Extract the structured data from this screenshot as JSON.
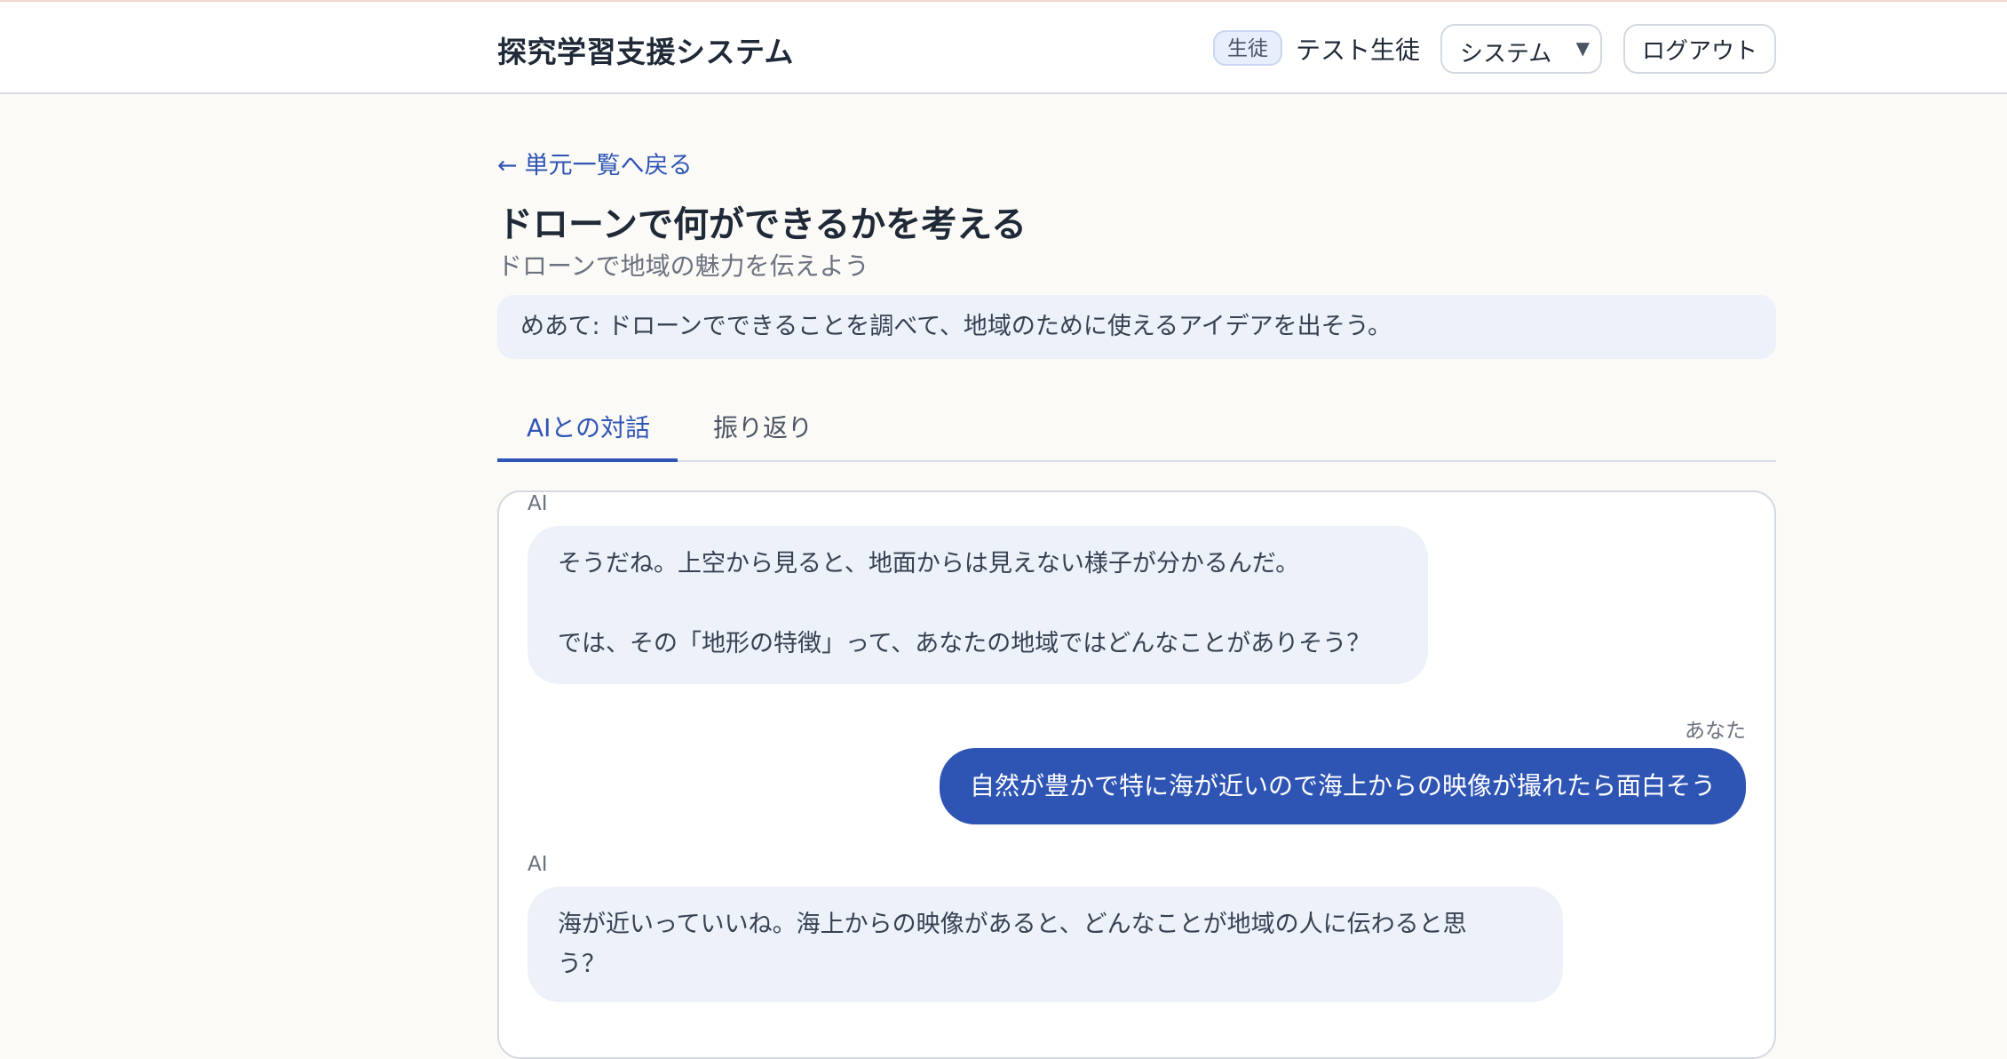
{
  "header": {
    "app_title": "探究学習支援システム",
    "role_badge": "生徒",
    "user_name": "テスト生徒",
    "mode_select": {
      "selected": "システム"
    },
    "logout_label": "ログアウト"
  },
  "unit": {
    "back_link": "単元一覧へ戻る",
    "title": "ドローンで何ができるかを考える",
    "subtitle": "ドローンで地域の魅力を伝えよう",
    "goal": "めあて: ドローンでできることを調べて、地域のために使えるアイデアを出そう。"
  },
  "tabs": [
    {
      "label": "AIとの対話",
      "active": true
    },
    {
      "label": "振り返り",
      "active": false
    }
  ],
  "chat": {
    "messages": [
      {
        "sender": "AI",
        "line1": "そうだね。上空から見ると、地面からは見えない様子が分かるんだ。",
        "line2": "では、その「地形の特徴」って、あなたの地域ではどんなことがありそう？"
      },
      {
        "sender": "あなた",
        "text": "自然が豊かで特に海が近いので海上からの映像が撮れたら面白そう"
      },
      {
        "sender": "AI",
        "line1": "海が近いっていいね。海上からの映像があると、どんなことが地域の人に伝わると思",
        "line2": "う？"
      }
    ]
  },
  "colors": {
    "accent": "#2f55b4",
    "ai_bubble": "#ecf1fa",
    "page_bg": "#fbfaf6"
  }
}
